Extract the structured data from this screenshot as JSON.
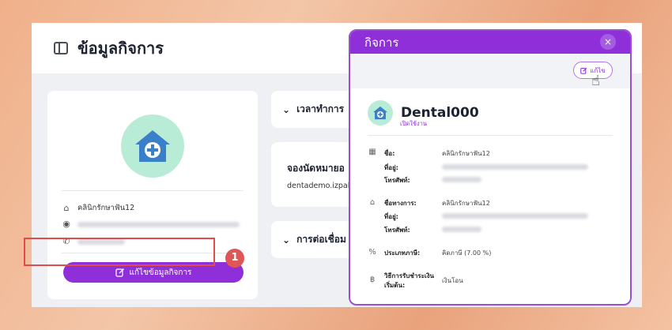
{
  "page": {
    "title": "ข้อมูลกิจการ"
  },
  "left_card": {
    "clinic_name": "คลินิกรักษาฟัน12",
    "edit_button": "แก้ไขข้อมูลกิจการ"
  },
  "step_badge": "1",
  "sections": {
    "hours": "เวลาทำการ",
    "booking_title": "จองนัดหมายอ",
    "booking_link": "dentademo.izpalap",
    "connect": "การต่อเชื่อม"
  },
  "modal": {
    "title": "กิจการ",
    "close": "×",
    "edit_label": "แก้ไข",
    "business_name": "Dental000",
    "status": "เปิดใช้งาน",
    "org_name_label": "ชื่อ:",
    "org_name_value": "คลินิกรักษาฟัน12",
    "org_address_label": "ที่อยู่:",
    "org_phone_label": "โทรศัพท์:",
    "trade_name_label": "ชื่อทางการ:",
    "trade_name_value": "คลินิกรักษาฟัน12",
    "trade_address_label": "ที่อยู่:",
    "trade_phone_label": "โทรศัพท์:",
    "tax_label": "ประเภทภาษี:",
    "tax_value": "คิดภาษี (7.00 %)",
    "payment_label_1": "วิธีการรับชำระเงิน",
    "payment_label_2": "เริ่มต้น:",
    "payment_value": "เงินโอน"
  },
  "colors": {
    "accent": "#8f2fd9",
    "logo_bg": "#b9ecd6",
    "logo_fg": "#3a80c9",
    "highlight": "#e14b4b"
  }
}
